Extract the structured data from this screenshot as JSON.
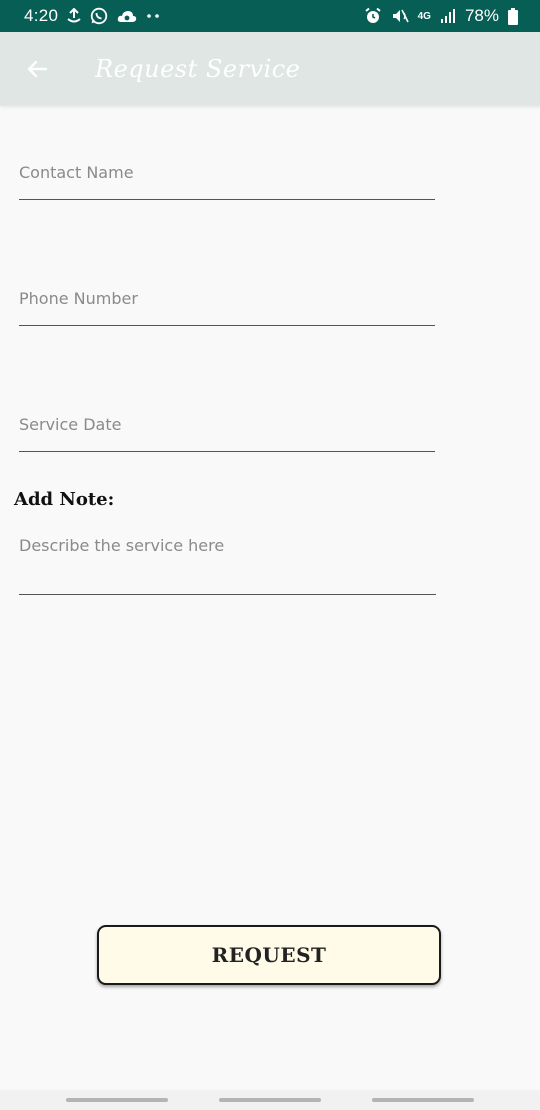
{
  "status_bar": {
    "time": "4:20",
    "left_icons": [
      "upload-icon",
      "whatsapp-icon",
      "cloud-icon",
      "more-dots-icon"
    ],
    "network_label": "4G",
    "battery_percent": "78%",
    "right_icons": [
      "alarm-icon",
      "mute-icon",
      "network-4g-icon",
      "signal-icon",
      "battery-icon"
    ]
  },
  "app_bar": {
    "title": "Request Service",
    "back_icon": "arrow-left-icon",
    "background_color": "#dfe6e3"
  },
  "form": {
    "contact_name": {
      "placeholder": "Contact Name",
      "value": ""
    },
    "phone_number": {
      "placeholder": "Phone Number",
      "value": ""
    },
    "service_date": {
      "placeholder": "Service Date",
      "value": ""
    },
    "note_label": "Add Note:",
    "note": {
      "placeholder": "Describe the service here",
      "value": ""
    }
  },
  "actions": {
    "request_label": "REQUEST",
    "button_color": "#fffbe8"
  },
  "colors": {
    "status_bar": "#075e54",
    "background": "#f9f9f9"
  }
}
